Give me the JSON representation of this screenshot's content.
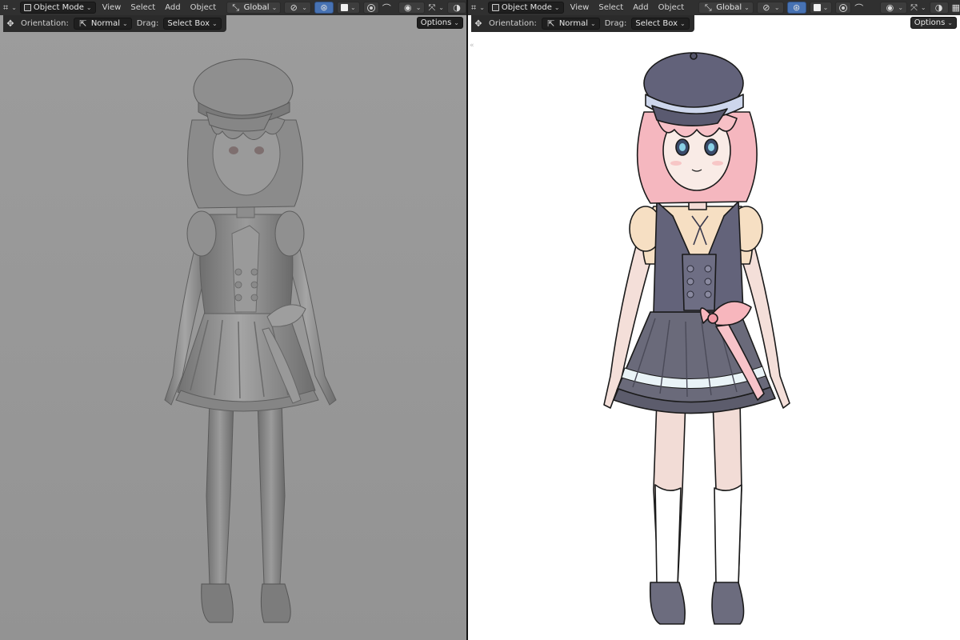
{
  "viewports": [
    {
      "header": {
        "mode": "Object Mode",
        "menus": [
          "View",
          "Select",
          "Add",
          "Object"
        ],
        "transform_orientation": "Global",
        "icons": [
          "editor-type-icon",
          "object-mode-icon",
          "transform-orientation-icon",
          "snap-icon",
          "proportional-editing-icon",
          "visibility-icon",
          "gizmo-icon",
          "overlay-icon",
          "shading-icon"
        ]
      },
      "tool_header": {
        "orientation_label": "Orientation:",
        "orientation_value": "Normal",
        "drag_label": "Drag:",
        "drag_value": "Select Box",
        "options_label": "Options"
      },
      "shading": "solid",
      "background_color": "#9a9a9a"
    },
    {
      "header": {
        "mode": "Object Mode",
        "menus": [
          "View",
          "Select",
          "Add",
          "Object"
        ],
        "transform_orientation": "Global"
      },
      "tool_header": {
        "orientation_label": "Orientation:",
        "orientation_value": "Normal",
        "drag_label": "Drag:",
        "drag_value": "Select Box",
        "options_label": "Options"
      },
      "shading": "toon",
      "background_color": "#ffffff"
    }
  ],
  "colors": {
    "header_bg": "#303030",
    "active_blue": "#4772b3",
    "sculpt_gray": "#8e8e8e",
    "hair_pink": "#f6b9c0",
    "dress_gray": "#5d5d6b",
    "blouse_cream": "#f3dcc0",
    "bow_pink": "#f7b6bd",
    "skin": "#f7dfd8"
  }
}
